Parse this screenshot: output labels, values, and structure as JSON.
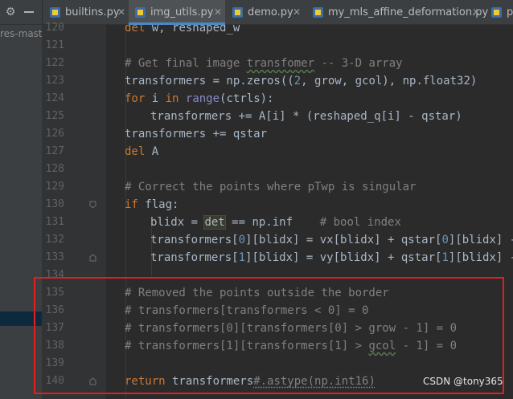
{
  "sidebar": {
    "project_label": "res-mast"
  },
  "tabs": [
    {
      "label": "builtins.py",
      "active": false
    },
    {
      "label": "img_utils.py",
      "active": true
    },
    {
      "label": "demo.py",
      "active": false
    },
    {
      "label": "my_mls_affine_deformation.py",
      "active": false
    },
    {
      "label": "p",
      "active": false
    }
  ],
  "editor": {
    "line_numbers": [
      "120",
      "121",
      "122",
      "123",
      "124",
      "125",
      "126",
      "127",
      "128",
      "129",
      "130",
      "131",
      "132",
      "133",
      "134",
      "135",
      "136",
      "137",
      "138",
      "139",
      "140"
    ],
    "code": {
      "l120_kw": "del",
      "l120_rest": " w, reshaped_w",
      "l122_cm_a": "# Get final image ",
      "l122_cm_b": "transfomer",
      "l122_cm_c": " -- 3-D array",
      "l123_a": "transformers = np.zeros((",
      "l123_n": "2",
      "l123_b": ", grow, gcol), np.float32)",
      "l124_kw1": "for",
      "l124_a": " i ",
      "l124_kw2": "in",
      "l124_sp": " ",
      "l124_bi": "range",
      "l124_b": "(ctrls):",
      "l125": "transformers += A[i] * (reshaped_q[i] - qstar)",
      "l126": "transformers += qstar",
      "l127_kw": "del",
      "l127_rest": " A",
      "l129": "# Correct the points where pTwp is singular",
      "l130_kw": "if",
      "l130_rest": " flag:",
      "l131_a": "blidx = ",
      "l131_det": "det",
      "l131_b": " == np.inf    ",
      "l131_cm": "# bool index",
      "l132_a": "transformers[",
      "l132_n0": "0",
      "l132_b": "][blidx] = vx[blidx] + qstar[",
      "l132_n1": "0",
      "l132_c": "][blidx] - ps",
      "l133_a": "transformers[",
      "l133_n0": "1",
      "l133_b": "][blidx] = vy[blidx] + qstar[",
      "l133_n1": "1",
      "l133_c": "][blidx] - ps",
      "l135": "# Removed the points outside the border",
      "l136": "# transformers[transformers < 0] = 0",
      "l137": "# transformers[0][transformers[0] > grow - 1] = 0",
      "l138_a": "# transformers[1][transformers[1] > ",
      "l138_b": "gcol",
      "l138_c": " - 1] = 0",
      "l140_kw": "return",
      "l140_a": " transformers",
      "l140_cm": "#.astype(np.int16)"
    }
  },
  "watermark": "CSDN @tony365",
  "colors": {
    "keyword": "#cc7832",
    "comment": "#808080",
    "number": "#6897bb",
    "builtin": "#8888c6",
    "annotation_box": "#e02020",
    "active_tab_underline": "#4a88c7"
  },
  "icons": [
    "gear-icon",
    "minimize-icon",
    "python-file-icon",
    "close-icon",
    "fold-marker-icon"
  ]
}
